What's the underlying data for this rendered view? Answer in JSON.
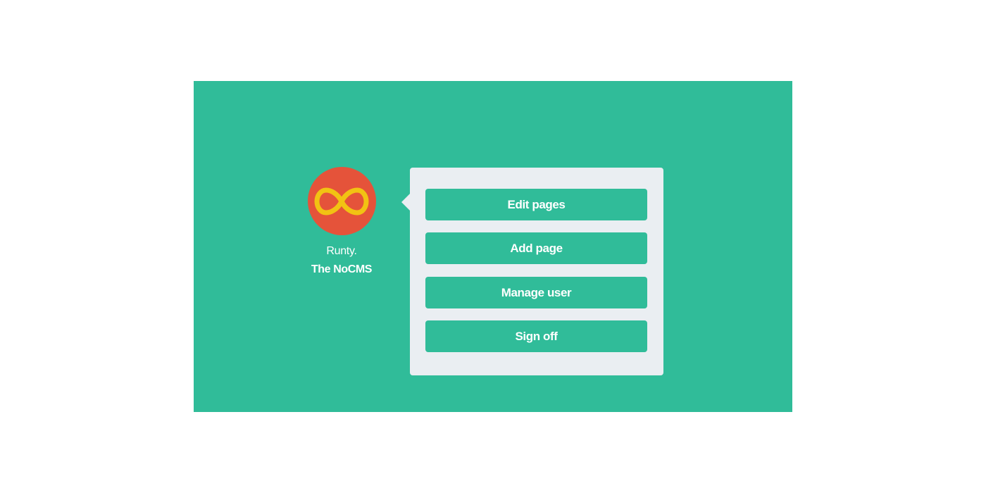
{
  "colors": {
    "background": "#ffffff",
    "stage": "#30bc99",
    "logo_circle": "#e5533a",
    "logo_symbol": "#f2c213",
    "panel": "#eaeef2",
    "button": "#30bc99",
    "text_light": "#ffffff"
  },
  "brand": {
    "logo_icon": "infinity-icon",
    "line1": "Runty.",
    "line2": "The NoCMS"
  },
  "menu": {
    "items": [
      {
        "label": "Edit pages"
      },
      {
        "label": "Add page"
      },
      {
        "label": "Manage user"
      },
      {
        "label": "Sign off"
      }
    ]
  }
}
